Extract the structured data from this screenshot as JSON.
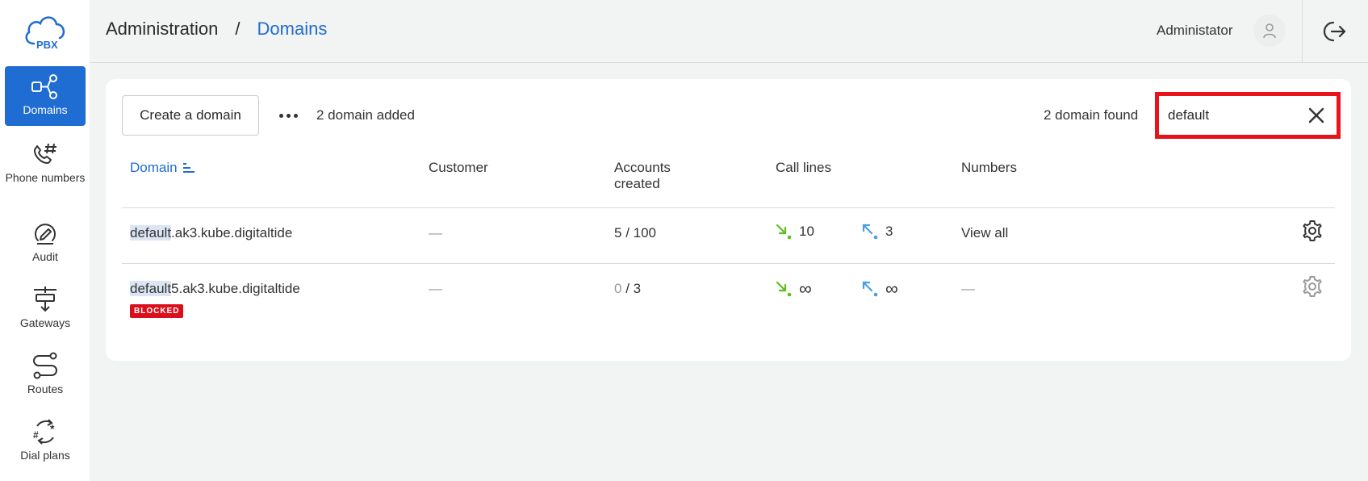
{
  "logo": {
    "text": "PBX",
    "icon": "cloud-icon"
  },
  "sidebar": {
    "items": [
      {
        "label": "Domains",
        "icon": "domains-icon",
        "active": true
      },
      {
        "label": "Phone numbers",
        "icon": "phone-hash-icon"
      },
      {
        "label": "Audit",
        "icon": "audit-icon"
      },
      {
        "label": "Gateways",
        "icon": "gateway-icon"
      },
      {
        "label": "Routes",
        "icon": "routes-icon"
      },
      {
        "label": "Dial plans",
        "icon": "dial-plan-icon"
      }
    ]
  },
  "header": {
    "breadcrumb_root": "Administration",
    "breadcrumb_sep": "/",
    "breadcrumb_current": "Domains",
    "user_name": "Administator",
    "logout_icon": "logout-icon"
  },
  "toolbar": {
    "create_label": "Create a domain",
    "added_count": "2 domain added",
    "found_count": "2 domain found",
    "search_value": "default",
    "search_placeholder": ""
  },
  "table": {
    "headers": {
      "domain": "Domain",
      "customer": "Customer",
      "accounts_line1": "Accounts",
      "accounts_line2": "created",
      "call_lines": "Call lines",
      "numbers": "Numbers"
    },
    "rows": [
      {
        "domain_match": "default",
        "domain_rest": ".ak3.kube.digitaltide",
        "customer": "—",
        "accounts_used": "5",
        "accounts_sep": " / ",
        "accounts_total": "100",
        "incoming": "10",
        "outgoing": "3",
        "numbers": "View all",
        "status": ""
      },
      {
        "domain_match": "default",
        "domain_rest": "5.ak3.kube.digitaltide",
        "customer": "—",
        "accounts_used": "0",
        "accounts_sep": " / ",
        "accounts_total": "3",
        "incoming": "∞",
        "outgoing": "∞",
        "numbers": "—",
        "status": "BLOCKED"
      }
    ]
  },
  "colors": {
    "accent": "#1f6cd2",
    "highlight_box": "#e8131b",
    "blocked": "#d9101c",
    "incoming": "#5cbf1f",
    "outgoing": "#4a9fe0"
  }
}
